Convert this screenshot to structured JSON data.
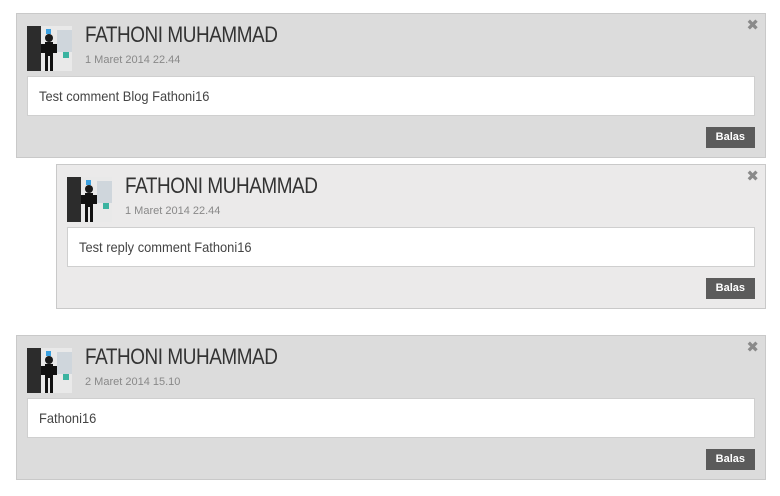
{
  "comments": [
    {
      "author": "FATHONI MUHAMMAD",
      "date": "1 Maret 2014 22.44",
      "text": "Test comment Blog Fathoni16",
      "reply_label": "Balas",
      "close_glyph": "✖"
    },
    {
      "author": "FATHONI MUHAMMAD",
      "date": "1 Maret 2014 22.44",
      "text": "Test reply comment Fathoni16",
      "reply_label": "Balas",
      "close_glyph": "✖"
    },
    {
      "author": "FATHONI MUHAMMAD",
      "date": "2 Maret 2014 15.10",
      "text": "Fathoni16",
      "reply_label": "Balas",
      "close_glyph": "✖"
    }
  ],
  "icons": {
    "close": "close-icon",
    "avatar": "avatar"
  },
  "colors": {
    "comment_bg": "#dcdcdc",
    "reply_bg": "#ebeaea",
    "button_bg": "#5b5b5b"
  }
}
